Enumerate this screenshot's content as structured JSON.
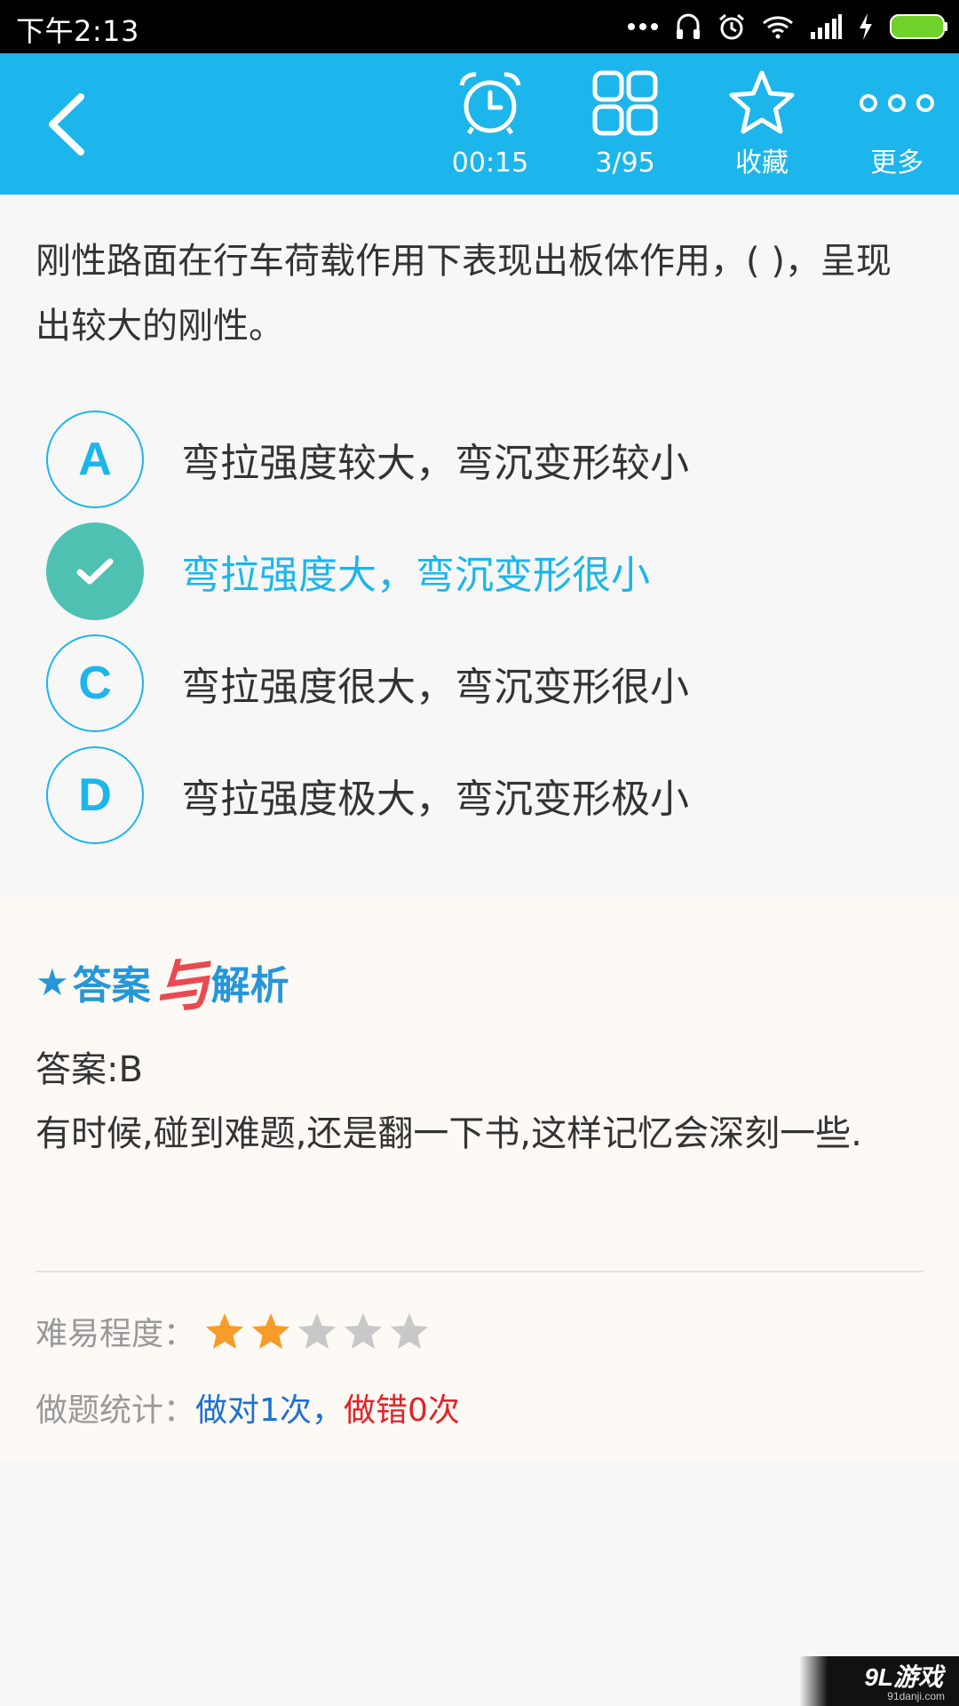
{
  "status_bar": {
    "time": "下午2:13"
  },
  "header": {
    "timer_label": "00:15",
    "progress_label": "3/95",
    "favorite_label": "收藏",
    "more_label": "更多",
    "accent_color": "#1cb5ec"
  },
  "question": {
    "text": "刚性路面在行车荷载作用下表现出板体作用，( )，呈现出较大的刚性。"
  },
  "options": [
    {
      "letter": "A",
      "text": "弯拉强度较大，弯沉变形较小",
      "selected": false
    },
    {
      "letter": "B",
      "text": "弯拉强度大，弯沉变形很小",
      "selected": true
    },
    {
      "letter": "C",
      "text": "弯拉强度很大，弯沉变形很小",
      "selected": false
    },
    {
      "letter": "D",
      "text": "弯拉强度极大，弯沉变形极小",
      "selected": false
    }
  ],
  "analysis": {
    "title_part1": "答案",
    "title_connector": "与",
    "title_part2": "解析",
    "answer": "答案:B",
    "explanation": "有时候,碰到难题,还是翻一下书,这样记忆会深刻一些.",
    "difficulty_label": "难易程度：",
    "difficulty_stars": 2,
    "difficulty_max": 5,
    "stats_label": "做题统计：",
    "stats_right": "做对1次",
    "stats_sep": "，",
    "stats_wrong": "做错0次"
  },
  "watermark": {
    "logo": "9L游戏",
    "url": "91danji.com"
  }
}
